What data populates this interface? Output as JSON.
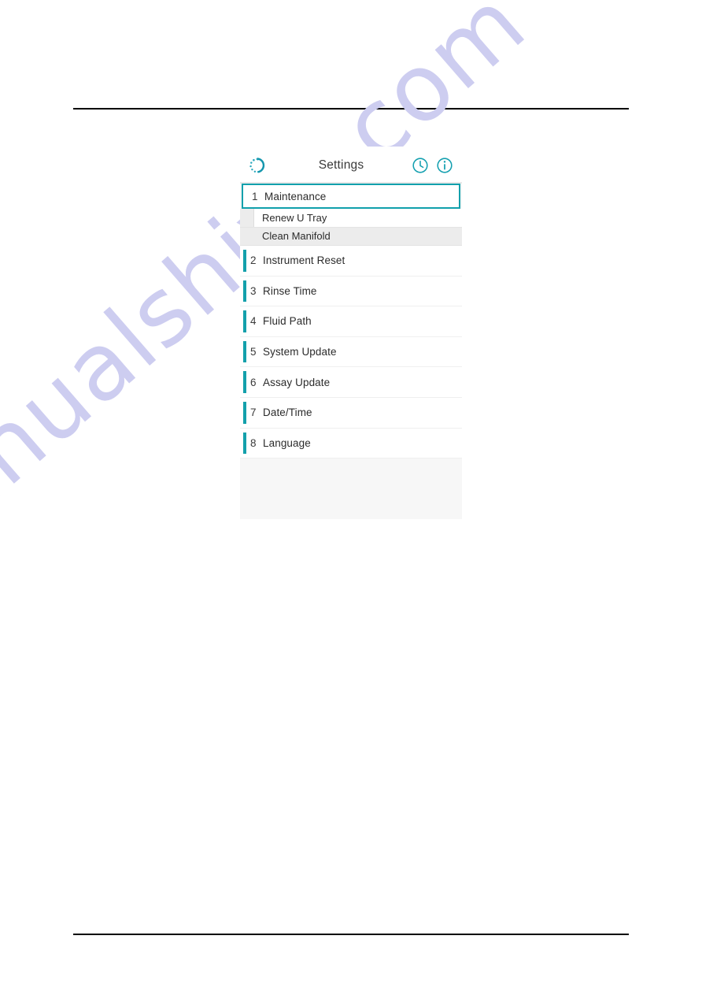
{
  "document": {
    "watermark": "manualshive.com",
    "rules": {
      "top": "page-top-rule",
      "bottom": "page-bottom-rule"
    }
  },
  "colors": {
    "accent_teal": "#13a0ab",
    "selected_border": "#11a0ac",
    "watermark": "#cdcdf0",
    "panel_bg": "#f7f7f7",
    "row_bg": "#ffffff",
    "subrow_alt_bg": "#ececec",
    "text": "#2b2b2b"
  },
  "screen": {
    "header": {
      "title": "Settings",
      "left_icon": "refresh-spinner-icon",
      "right_icons": [
        {
          "name": "clock-icon"
        },
        {
          "name": "info-icon"
        }
      ]
    },
    "menu": {
      "selected_index": 1,
      "items": [
        {
          "index": "1",
          "label": "Maintenance",
          "selected": true
        },
        {
          "index": "2",
          "label": "Instrument Reset",
          "selected": false
        },
        {
          "index": "3",
          "label": "Rinse Time",
          "selected": false
        },
        {
          "index": "4",
          "label": "Fluid Path",
          "selected": false
        },
        {
          "index": "5",
          "label": "System Update",
          "selected": false
        },
        {
          "index": "6",
          "label": "Assay Update",
          "selected": false
        },
        {
          "index": "7",
          "label": "Date/Time",
          "selected": false
        },
        {
          "index": "8",
          "label": "Language",
          "selected": false
        }
      ],
      "submenu": {
        "parent": "Maintenance",
        "items": [
          {
            "label": "Renew U Tray",
            "highlighted": false
          },
          {
            "label": "Clean Manifold",
            "highlighted": true
          }
        ]
      }
    }
  }
}
